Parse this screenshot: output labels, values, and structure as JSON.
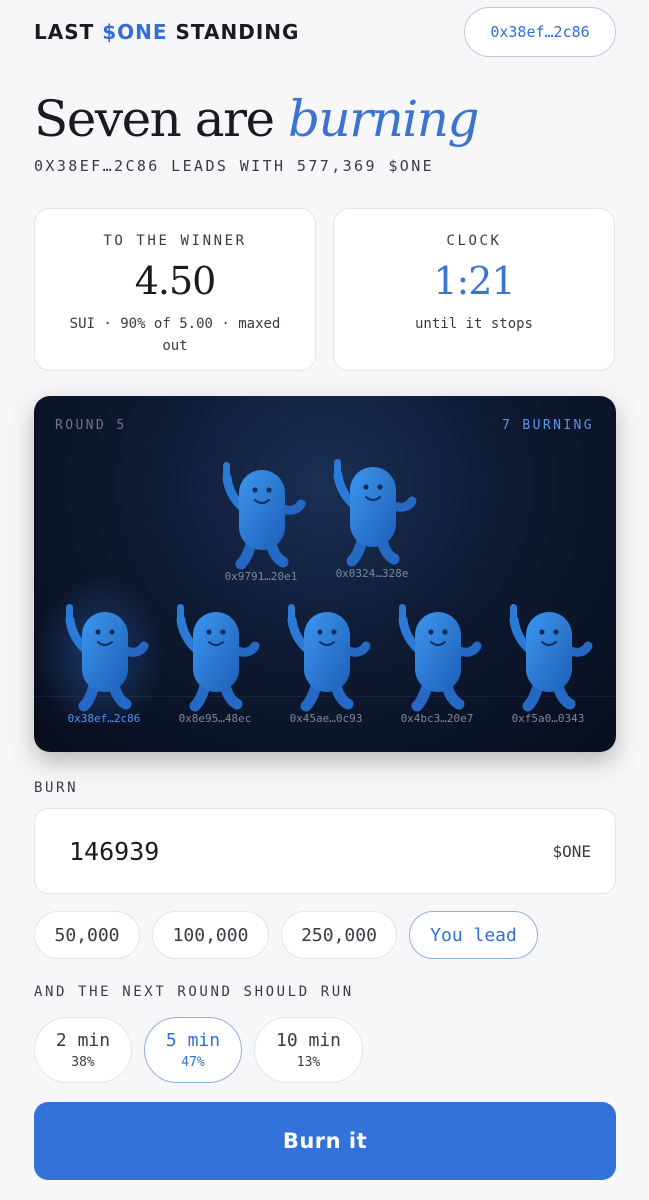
{
  "header": {
    "brand_prefix": "LAST ",
    "brand_accent": "$ONE",
    "brand_suffix": " STANDING",
    "wallet": "0x38ef…2c86"
  },
  "hero": {
    "headline_plain": "Seven are ",
    "headline_emphasis": "burning",
    "subline": "0X38EF…2C86 LEADS WITH 577,369 $ONE"
  },
  "prize": {
    "label": "TO THE WINNER",
    "value": "4.50",
    "note": "SUI · 90% of 5.00 · maxed out"
  },
  "clock": {
    "label": "CLOCK",
    "value": "1:21",
    "note": "until it stops"
  },
  "arena": {
    "round": "ROUND 5",
    "burning": "7 BURNING",
    "players": [
      {
        "address": "0x9791…20e1",
        "lead": false
      },
      {
        "address": "0x0324…328e",
        "lead": false
      },
      {
        "address": "0x38ef…2c86",
        "lead": true
      },
      {
        "address": "0x8e95…48ec",
        "lead": false
      },
      {
        "address": "0x45ae…0c93",
        "lead": false
      },
      {
        "address": "0x4bc3…20e7",
        "lead": false
      },
      {
        "address": "0xf5a0…0343",
        "lead": false
      }
    ]
  },
  "burn": {
    "label": "BURN",
    "amount": "146939",
    "unit": "$ONE",
    "presets": [
      "50,000",
      "100,000",
      "250,000",
      "You lead"
    ]
  },
  "next_round": {
    "label": "AND THE NEXT ROUND SHOULD RUN",
    "options": [
      {
        "label": "2 min",
        "percent": "38%",
        "selected": false
      },
      {
        "label": "5 min",
        "percent": "47%",
        "selected": true
      },
      {
        "label": "10 min",
        "percent": "13%",
        "selected": false
      }
    ]
  },
  "action": {
    "label": "Burn it"
  },
  "colors": {
    "accent": "#3272d9",
    "background": "#f7f7f9",
    "arena": "#0e1a33",
    "creature": "#2f7fd9"
  }
}
